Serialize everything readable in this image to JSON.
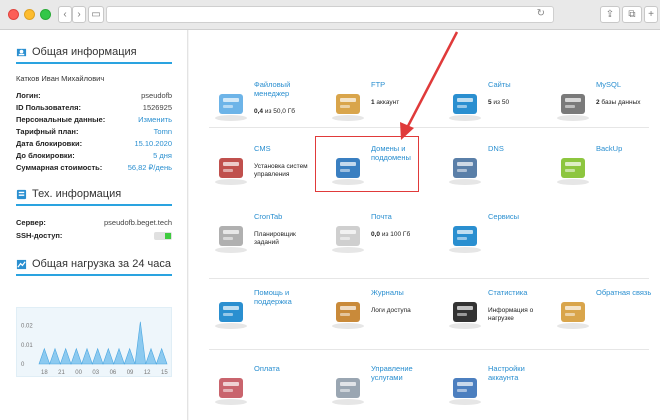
{
  "browser": {
    "back_glyph": "‹",
    "forward_glyph": "›",
    "sidebar_glyph": "▭",
    "reload_glyph": "↻",
    "share_glyph": "⇪",
    "tabs_glyph": "⧉",
    "plus_glyph": "+"
  },
  "sidebar": {
    "general": {
      "title": "Общая информация",
      "user_name": "Катков Иван Михайлович",
      "rows": [
        {
          "key": "Логин:",
          "value": "pseudofb"
        },
        {
          "key": "ID Пользователя:",
          "value": "1526925"
        },
        {
          "key": "Персональные данные:",
          "value": "Изменить"
        },
        {
          "key": "Тарифный план:",
          "value": "Tomn"
        },
        {
          "key": "Дата блокировки:",
          "value": "15.10.2020"
        },
        {
          "key": "До блокировки:",
          "value": "5 дня"
        },
        {
          "key": "Суммарная стоимость:",
          "value": "56,82 ₽/день"
        }
      ]
    },
    "tech": {
      "title": "Тех. информация",
      "rows": [
        {
          "key": "Сервер:",
          "value": "pseudofb.beget.tech"
        },
        {
          "key": "SSH-доступ:",
          "value": ""
        }
      ]
    },
    "load": {
      "title": "Общая нагрузка за 24 часа"
    }
  },
  "chart_data": {
    "type": "area",
    "title": "Общая нагрузка за 24 часа",
    "x_tick_labels": [
      "18",
      "21",
      "00",
      "03",
      "06",
      "09",
      "12",
      "15"
    ],
    "y_tick_labels": [
      "0.02",
      "0.01",
      "0"
    ],
    "ylim": [
      0,
      0.025
    ],
    "values": [
      0,
      0.008,
      0,
      0.008,
      0,
      0.008,
      0,
      0.008,
      0,
      0.008,
      0,
      0.008,
      0,
      0.008,
      0,
      0.008,
      0,
      0.008,
      0,
      0.022,
      0,
      0.008,
      0,
      0.008,
      0
    ],
    "color": "#8ccaf0"
  },
  "main": {
    "tiles": [
      {
        "label": "Файловый менеджер",
        "sub_bold": "0,4",
        "sub": " из 50,0 Гб",
        "icon": "file-manager-icon"
      },
      {
        "label": "FTP",
        "sub_bold": "1",
        "sub": " аккаунт",
        "icon": "ftp-icon"
      },
      {
        "label": "Сайты",
        "sub_bold": "5",
        "sub": " из 50",
        "icon": "sites-icon"
      },
      {
        "label": "MySQL",
        "sub_bold": "2",
        "sub": " базы данных",
        "icon": "mysql-icon"
      },
      {
        "label": "CMS",
        "sub_bold": "",
        "sub": "Установка систем управления",
        "icon": "cms-icon"
      },
      {
        "label": "Домены и поддомены",
        "sub_bold": "",
        "sub": "",
        "icon": "domains-icon"
      },
      {
        "label": "DNS",
        "sub_bold": "",
        "sub": "",
        "icon": "dns-icon"
      },
      {
        "label": "BackUp",
        "sub_bold": "",
        "sub": "",
        "icon": "backup-icon"
      },
      {
        "label": "CronTab",
        "sub_bold": "",
        "sub": "Планировщик заданий",
        "icon": "crontab-icon"
      },
      {
        "label": "Почта",
        "sub_bold": "0,0",
        "sub": " из 100 Гб",
        "icon": "mail-icon"
      },
      {
        "label": "Сервисы",
        "sub_bold": "",
        "sub": "",
        "icon": "services-icon"
      },
      {
        "label": "",
        "sub_bold": "",
        "sub": "",
        "icon": ""
      },
      {
        "label": "Помощь и поддержка",
        "sub_bold": "",
        "sub": "",
        "icon": "help-icon"
      },
      {
        "label": "Журналы",
        "sub_bold": "",
        "sub": "Логи доступа",
        "icon": "logs-icon"
      },
      {
        "label": "Статистика",
        "sub_bold": "",
        "sub": "Информация о нагрузке",
        "icon": "statistics-icon"
      },
      {
        "label": "Обратная связь",
        "sub_bold": "",
        "sub": "",
        "icon": "feedback-icon"
      },
      {
        "label": "Оплата",
        "sub_bold": "",
        "sub": "",
        "icon": "payment-icon"
      },
      {
        "label": "Управление услугами",
        "sub_bold": "",
        "sub": "",
        "icon": "services-management-icon"
      },
      {
        "label": "Настройки аккаунта",
        "sub_bold": "",
        "sub": "",
        "icon": "account-settings-icon"
      }
    ],
    "annotation_color": "#e03a3a"
  }
}
